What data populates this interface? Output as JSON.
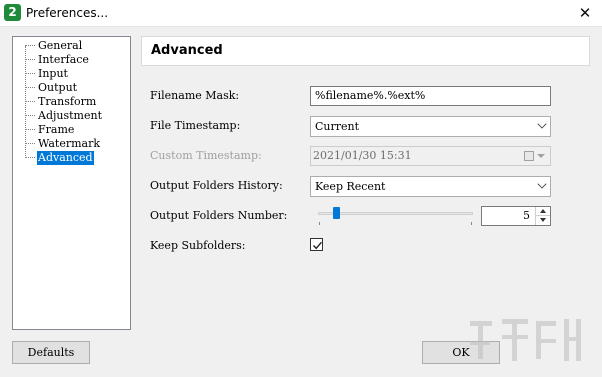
{
  "window": {
    "icon_text": "2",
    "title": "Preferences...",
    "close_glyph": "✕"
  },
  "tree": {
    "items": [
      {
        "label": "General"
      },
      {
        "label": "Interface"
      },
      {
        "label": "Input"
      },
      {
        "label": "Output"
      },
      {
        "label": "Transform"
      },
      {
        "label": "Adjustment"
      },
      {
        "label": "Frame"
      },
      {
        "label": "Watermark"
      },
      {
        "label": "Advanced",
        "selected": true
      }
    ]
  },
  "panel": {
    "title": "Advanced"
  },
  "form": {
    "filename_mask": {
      "label": "Filename Mask:",
      "value": "%filename%.%ext%"
    },
    "file_timestamp": {
      "label": "File Timestamp:",
      "value": "Current"
    },
    "custom_timestamp": {
      "label": "Custom Timestamp:",
      "value": "2021/01/30 15:31",
      "disabled": true
    },
    "output_folders_history": {
      "label": "Output Folders History:",
      "value": "Keep Recent"
    },
    "output_folders_number": {
      "label": "Output Folders Number:",
      "value": "5",
      "slider_fraction": 0.1
    },
    "keep_subfolders": {
      "label": "Keep Subfolders:",
      "checked": true
    }
  },
  "buttons": {
    "defaults": "Defaults",
    "ok": "OK"
  },
  "colors": {
    "selection": "#0078d7",
    "window_bg": "#f0f0f0",
    "app_icon": "#1f8a3a"
  },
  "icons": {
    "app": "app-logo-icon",
    "close": "close-icon",
    "calendar": "calendar-icon",
    "dropdown": "chevron-down-icon",
    "check": "checkmark-icon"
  }
}
